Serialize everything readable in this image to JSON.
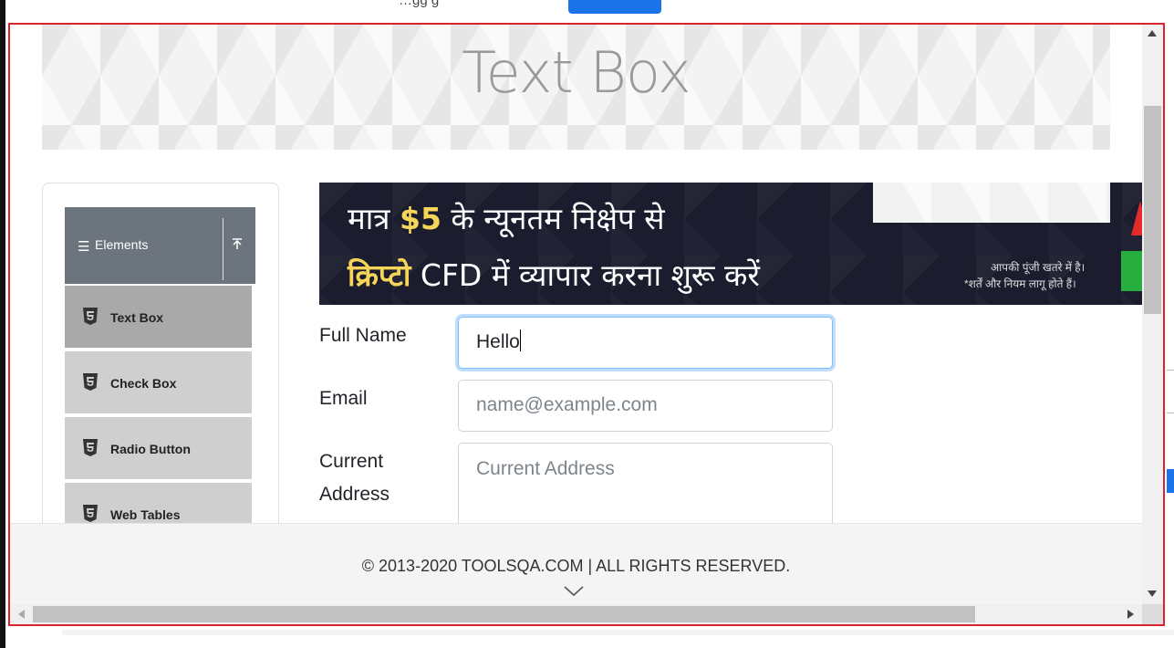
{
  "page": {
    "title": "Text Box",
    "top_clipped_text": "…gg g"
  },
  "sidebar": {
    "group_label": "Elements",
    "group_icon": "hamburger-icon",
    "collapse_icon": "upload-arrow-icon",
    "items": [
      {
        "label": "Text Box",
        "icon": "html5-icon",
        "active": true
      },
      {
        "label": "Check Box",
        "icon": "html5-icon",
        "active": false
      },
      {
        "label": "Radio Button",
        "icon": "html5-icon",
        "active": false
      },
      {
        "label": "Web Tables",
        "icon": "html5-icon",
        "active": false
      }
    ]
  },
  "ad": {
    "line1_pre": "मात्र ",
    "line1_amount": "$5",
    "line1_post": " के न्यूनतम निक्षेप से",
    "line2_highlight": "क्रिप्टो",
    "line2_post": " CFD में  व्यापार करना शुरू करें",
    "disclaimer1": "आपकी पूंजी खतरे में है।",
    "disclaimer2": "*शर्तें और नियम लागू होते हैं।"
  },
  "form": {
    "full_name_label": "Full Name",
    "full_name_value": "Hello",
    "email_label": "Email",
    "email_placeholder": "name@example.com",
    "address_label_1": "Current",
    "address_label_2": "Address",
    "address_placeholder": "Current Address"
  },
  "footer": {
    "copyright": "© 2013-2020 TOOLSQA.COM | ALL RIGHTS RESERVED."
  },
  "colors": {
    "frame_border": "#d9232d",
    "elements_header_bg": "#6c757d",
    "menu_item_bg": "#cfcfcf",
    "menu_item_active_bg": "#a9a9a9",
    "input_focus": "#80bdff",
    "ad_bg": "#1b1d2e",
    "ad_highlight": "#f7d558"
  }
}
